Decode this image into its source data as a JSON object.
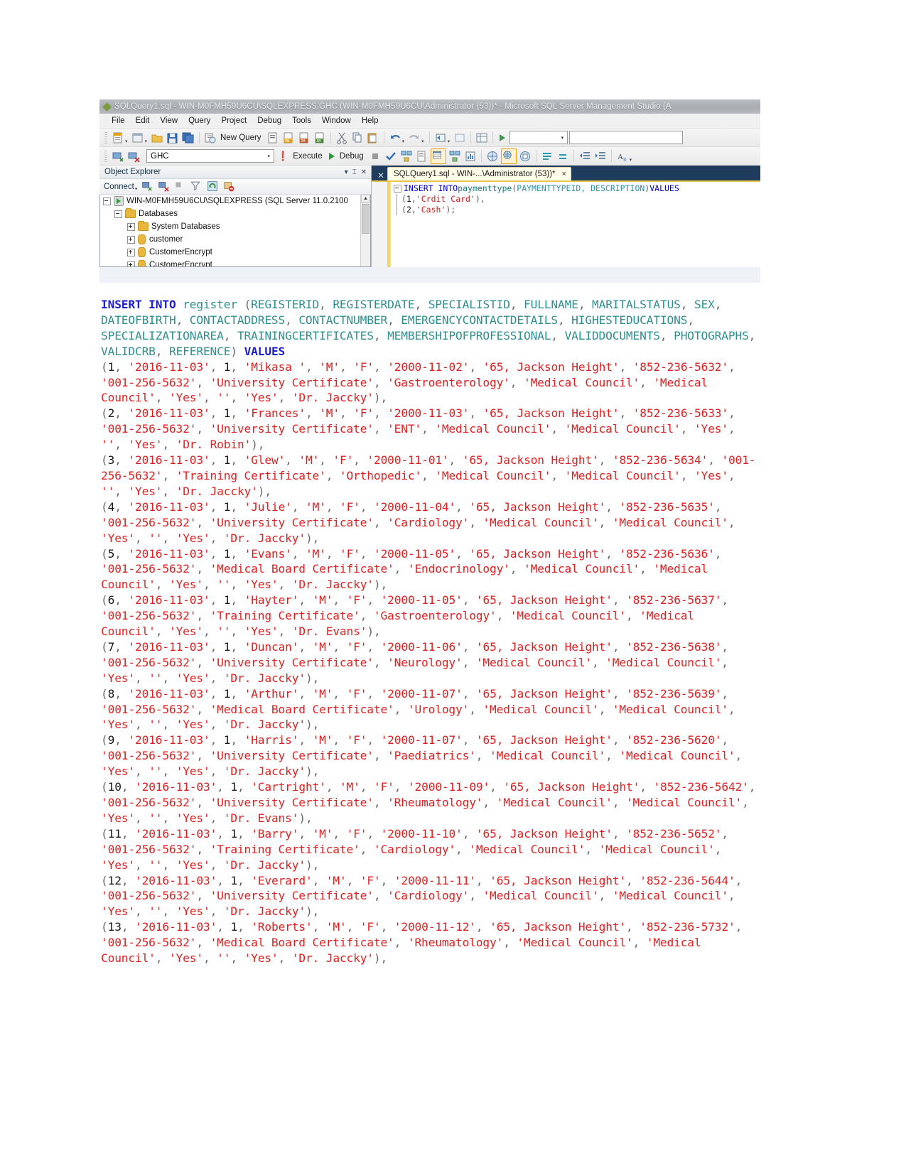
{
  "window": {
    "title": "SQLQuery1.sql - WIN-M0FMH59U6CU\\SQLEXPRESS.GHC (WIN-M0FMH59U6CU\\Administrator (53))* - Microsoft SQL Server Management Studio (A",
    "app_icon": "ssms-icon"
  },
  "menubar": {
    "items": [
      "File",
      "Edit",
      "View",
      "Query",
      "Project",
      "Debug",
      "Tools",
      "Window",
      "Help"
    ]
  },
  "toolbar_main": {
    "new_query_label": "New Query"
  },
  "toolbar_query": {
    "database_combo_value": "GHC",
    "execute_label": "Execute",
    "debug_label": "Debug"
  },
  "object_explorer": {
    "title": "Object Explorer",
    "connect_label": "Connect",
    "tree": [
      {
        "label": "WIN-M0FMH59U6CU\\SQLEXPRESS (SQL Server 11.0.2100",
        "icon": "server-icon",
        "state": "expanded",
        "indent": 0
      },
      {
        "label": "Databases",
        "icon": "folder-icon",
        "state": "expanded",
        "indent": 1
      },
      {
        "label": "System Databases",
        "icon": "folder-icon",
        "state": "collapsed",
        "indent": 2
      },
      {
        "label": "customer",
        "icon": "database-icon",
        "state": "collapsed",
        "indent": 2
      },
      {
        "label": "CustomerEncrypt",
        "icon": "database-icon",
        "state": "collapsed",
        "indent": 2
      },
      {
        "label": "CustomerEncrypt",
        "icon": "database-icon",
        "state": "collapsed",
        "indent": 2
      }
    ]
  },
  "editor": {
    "tab_label": "SQLQuery1.sql - WIN-...\\Administrator (53))*",
    "tab_close": "×",
    "code": {
      "line1": [
        {
          "text": "INSERT INTO ",
          "cls": "kw"
        },
        {
          "text": "paymenttype ",
          "cls": "tbl"
        },
        {
          "text": "(",
          "cls": "pun"
        },
        {
          "text": "PAYMENTTYPEID, DESCRIPTION",
          "cls": "col"
        },
        {
          "text": ") ",
          "cls": "pun"
        },
        {
          "text": "VALUES",
          "cls": "kw"
        }
      ],
      "line2": [
        {
          "text": "(",
          "cls": "pun"
        },
        {
          "text": "1",
          "cls": "num"
        },
        {
          "text": ", ",
          "cls": "pun"
        },
        {
          "text": "'Crdit Card'",
          "cls": "str"
        },
        {
          "text": "),",
          "cls": "pun"
        }
      ],
      "line3": [
        {
          "text": "(",
          "cls": "pun"
        },
        {
          "text": "2",
          "cls": "num"
        },
        {
          "text": ", ",
          "cls": "pun"
        },
        {
          "text": "'Cash'",
          "cls": "str"
        },
        {
          "text": ");",
          "cls": "pun"
        }
      ]
    }
  },
  "sql_document": {
    "statement_keyword": "INSERT INTO",
    "table_name": "register",
    "columns": [
      "REGISTERID",
      "REGISTERDATE",
      "SPECIALISTID",
      "FULLNAME",
      "MARITALSTATUS",
      "SEX",
      "DATEOFBIRTH",
      "CONTACTADDRESS",
      "CONTACTNUMBER",
      "EMERGENCYCONTACTDETAILS",
      "HIGHESTEDUCATIONS",
      "SPECIALIZATIONAREA",
      "TRAININGCERTIFICATES",
      "MEMBERSHIPOFPROFESSIONAL",
      "VALIDDOCUMENTS",
      "PHOTOGRAPHS",
      "VALIDCRB",
      "REFERENCE"
    ],
    "values_keyword": "VALUES",
    "rows": [
      {
        "registerid": "1",
        "registerdate": "2016-11-03",
        "specialistid": "1",
        "fullname": "Mikasa ",
        "maritalstatus": "M",
        "sex": "F",
        "dateofbirth": "2000-11-02",
        "contactaddress": "65, Jackson Height",
        "contactnumber": "852-236-5632",
        "emergencycontactdetails": "001-256-5632",
        "highesteducations": "University Certificate",
        "specializationarea": "Gastroenterology",
        "trainingcertificates": "Medical Council",
        "membershipofprofessional": "Medical Council",
        "validdocuments": "Yes",
        "photographs": "",
        "validcrb": "Yes",
        "reference": "Dr. Jaccky"
      },
      {
        "registerid": "2",
        "registerdate": "2016-11-03",
        "specialistid": "1",
        "fullname": "Frances",
        "maritalstatus": "M",
        "sex": "F",
        "dateofbirth": "2000-11-03",
        "contactaddress": "65, Jackson Height",
        "contactnumber": "852-236-5633",
        "emergencycontactdetails": "001-256-5632",
        "highesteducations": "University Certificate",
        "specializationarea": "ENT",
        "trainingcertificates": "Medical Council",
        "membershipofprofessional": "Medical Council",
        "validdocuments": "Yes",
        "photographs": "",
        "validcrb": "Yes",
        "reference": "Dr. Robin"
      },
      {
        "registerid": "3",
        "registerdate": "2016-11-03",
        "specialistid": "1",
        "fullname": "Glew",
        "maritalstatus": "M",
        "sex": "F",
        "dateofbirth": "2000-11-01",
        "contactaddress": "65, Jackson Height",
        "contactnumber": "852-236-5634",
        "emergencycontactdetails": "001-256-5632",
        "highesteducations": "Training Certificate",
        "specializationarea": "Orthopedic",
        "trainingcertificates": "Medical Council",
        "membershipofprofessional": "Medical Council",
        "validdocuments": "Yes",
        "photographs": "",
        "validcrb": "Yes",
        "reference": "Dr. Jaccky"
      },
      {
        "registerid": "4",
        "registerdate": "2016-11-03",
        "specialistid": "1",
        "fullname": "Julie",
        "maritalstatus": "M",
        "sex": "F",
        "dateofbirth": "2000-11-04",
        "contactaddress": "65, Jackson Height",
        "contactnumber": "852-236-5635",
        "emergencycontactdetails": "001-256-5632",
        "highesteducations": "University Certificate",
        "specializationarea": "Cardiology",
        "trainingcertificates": "Medical Council",
        "membershipofprofessional": "Medical Council",
        "validdocuments": "Yes",
        "photographs": "",
        "validcrb": "Yes",
        "reference": "Dr. Jaccky"
      },
      {
        "registerid": "5",
        "registerdate": "2016-11-03",
        "specialistid": "1",
        "fullname": "Evans",
        "maritalstatus": "M",
        "sex": "F",
        "dateofbirth": "2000-11-05",
        "contactaddress": "65, Jackson Height",
        "contactnumber": "852-236-5636",
        "emergencycontactdetails": "001-256-5632",
        "highesteducations": "Medical Board Certificate",
        "specializationarea": "Endocrinology",
        "trainingcertificates": "Medical Council",
        "membershipofprofessional": "Medical Council",
        "validdocuments": "Yes",
        "photographs": "",
        "validcrb": "Yes",
        "reference": "Dr. Jaccky"
      },
      {
        "registerid": "6",
        "registerdate": "2016-11-03",
        "specialistid": "1",
        "fullname": "Hayter",
        "maritalstatus": "M",
        "sex": "F",
        "dateofbirth": "2000-11-05",
        "contactaddress": "65, Jackson Height",
        "contactnumber": "852-236-5637",
        "emergencycontactdetails": "001-256-5632",
        "highesteducations": "Training Certificate",
        "specializationarea": "Gastroenterology",
        "trainingcertificates": "Medical Council",
        "membershipofprofessional": "Medical Council",
        "validdocuments": "Yes",
        "photographs": "",
        "validcrb": "Yes",
        "reference": "Dr. Evans"
      },
      {
        "registerid": "7",
        "registerdate": "2016-11-03",
        "specialistid": "1",
        "fullname": "Duncan",
        "maritalstatus": "M",
        "sex": "F",
        "dateofbirth": "2000-11-06",
        "contactaddress": "65, Jackson Height",
        "contactnumber": "852-236-5638",
        "emergencycontactdetails": "001-256-5632",
        "highesteducations": "University Certificate",
        "specializationarea": "Neurology",
        "trainingcertificates": "Medical Council",
        "membershipofprofessional": "Medical Council",
        "validdocuments": "Yes",
        "photographs": "",
        "validcrb": "Yes",
        "reference": "Dr. Jaccky"
      },
      {
        "registerid": "8",
        "registerdate": "2016-11-03",
        "specialistid": "1",
        "fullname": "Arthur",
        "maritalstatus": "M",
        "sex": "F",
        "dateofbirth": "2000-11-07",
        "contactaddress": "65, Jackson Height",
        "contactnumber": "852-236-5639",
        "emergencycontactdetails": "001-256-5632",
        "highesteducations": "Medical Board Certificate",
        "specializationarea": "Urology",
        "trainingcertificates": "Medical Council",
        "membershipofprofessional": "Medical Council",
        "validdocuments": "Yes",
        "photographs": "",
        "validcrb": "Yes",
        "reference": "Dr. Jaccky"
      },
      {
        "registerid": "9",
        "registerdate": "2016-11-03",
        "specialistid": "1",
        "fullname": "Harris",
        "maritalstatus": "M",
        "sex": "F",
        "dateofbirth": "2000-11-07",
        "contactaddress": "65, Jackson Height",
        "contactnumber": "852-236-5620",
        "emergencycontactdetails": "001-256-5632",
        "highesteducations": "University Certificate",
        "specializationarea": "Paediatrics",
        "trainingcertificates": "Medical Council",
        "membershipofprofessional": "Medical Council",
        "validdocuments": "Yes",
        "photographs": "",
        "validcrb": "Yes",
        "reference": "Dr. Jaccky"
      },
      {
        "registerid": "10",
        "registerdate": "2016-11-03",
        "specialistid": "1",
        "fullname": "Cartright",
        "maritalstatus": "M",
        "sex": "F",
        "dateofbirth": "2000-11-09",
        "contactaddress": "65, Jackson Height",
        "contactnumber": "852-236-5642",
        "emergencycontactdetails": "001-256-5632",
        "highesteducations": "University Certificate",
        "specializationarea": "Rheumatology",
        "trainingcertificates": "Medical Council",
        "membershipofprofessional": "Medical Council",
        "validdocuments": "Yes",
        "photographs": "",
        "validcrb": "Yes",
        "reference": "Dr. Evans"
      },
      {
        "registerid": "11",
        "registerdate": "2016-11-03",
        "specialistid": "1",
        "fullname": "Barry",
        "maritalstatus": "M",
        "sex": "F",
        "dateofbirth": "2000-11-10",
        "contactaddress": "65, Jackson Height",
        "contactnumber": "852-236-5652",
        "emergencycontactdetails": "001-256-5632",
        "highesteducations": "Training Certificate",
        "specializationarea": "Cardiology",
        "trainingcertificates": "Medical Council",
        "membershipofprofessional": "Medical Council",
        "validdocuments": "Yes",
        "photographs": "",
        "validcrb": "Yes",
        "reference": "Dr. Jaccky"
      },
      {
        "registerid": "12",
        "registerdate": "2016-11-03",
        "specialistid": "1",
        "fullname": "Everard",
        "maritalstatus": "M",
        "sex": "F",
        "dateofbirth": "2000-11-11",
        "contactaddress": "65, Jackson Height",
        "contactnumber": "852-236-5644",
        "emergencycontactdetails": "001-256-5632",
        "highesteducations": "University Certificate",
        "specializationarea": "Cardiology",
        "trainingcertificates": "Medical Council",
        "membershipofprofessional": "Medical Council",
        "validdocuments": "Yes",
        "photographs": "",
        "validcrb": "Yes",
        "reference": "Dr. Jaccky"
      },
      {
        "registerid": "13",
        "registerdate": "2016-11-03",
        "specialistid": "1",
        "fullname": "Roberts",
        "maritalstatus": "M",
        "sex": "F",
        "dateofbirth": "2000-11-12",
        "contactaddress": "65, Jackson Height",
        "contactnumber": "852-236-5732",
        "emergencycontactdetails": "001-256-5632",
        "highesteducations": "Medical Board Certificate",
        "specializationarea": "Rheumatology",
        "trainingcertificates": "Medical Council",
        "membershipofprofessional": "Medical Council",
        "validdocuments": "Yes",
        "photographs": "",
        "validcrb": "Yes",
        "reference": "Dr. Jaccky"
      }
    ]
  },
  "colors": {
    "keyword": "#1d1dd6",
    "identifier": "#2f8f8f",
    "string": "#e02020",
    "punctuation": "#6a6a6a",
    "tab_accent": "#e8c84a"
  }
}
